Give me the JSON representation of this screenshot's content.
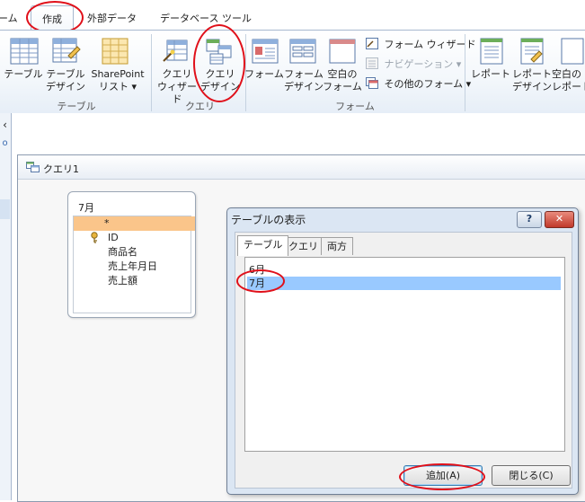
{
  "tabs": [
    "ーム",
    "作成",
    "外部データ",
    "データベース ツール"
  ],
  "ribbon": {
    "table_group": {
      "label": "テーブル",
      "buttons": [
        {
          "line1": "テーブル",
          "line2": ""
        },
        {
          "line1": "テーブル",
          "line2": "デザイン"
        },
        {
          "line1": "SharePoint",
          "line2": "リスト ▾"
        }
      ]
    },
    "query_group": {
      "label": "クエリ",
      "buttons": [
        {
          "line1": "クエリ",
          "line2": "ウィザード"
        },
        {
          "line1": "クエリ",
          "line2": "デザイン"
        }
      ]
    },
    "form_group": {
      "label": "フォーム",
      "buttons": [
        {
          "line1": "フォーム",
          "line2": ""
        },
        {
          "line1": "フォーム",
          "line2": "デザイン"
        },
        {
          "line1": "空白の",
          "line2": "フォーム"
        }
      ],
      "small": [
        "フォーム ウィザード",
        "ナビゲーション ▾",
        "その他のフォーム ▾"
      ]
    },
    "report_group": {
      "buttons": [
        {
          "line1": "レポート",
          "line2": ""
        },
        {
          "line1": "レポート",
          "line2": "デザイン"
        },
        {
          "line1": "空白の",
          "line2": "レポート"
        }
      ]
    }
  },
  "left_strip": {
    "glyph1": "‹",
    "glyph2": "o"
  },
  "query_window": {
    "title": "クエリ1"
  },
  "field_list": {
    "table": "7月",
    "fields": [
      "*",
      "ID",
      "商品名",
      "売上年月日",
      "売上額"
    ]
  },
  "dialog": {
    "title": "テーブルの表示",
    "help": "?",
    "close": "✕",
    "tabs": [
      "テーブル",
      "クエリ",
      "両方"
    ],
    "items": [
      "6月",
      "7月"
    ],
    "selected_index": 1,
    "add_button": "追加(A)",
    "close_button": "閉じる(C)"
  },
  "colors": {
    "highlight": "#e0101a",
    "selection": "#99c9ff"
  }
}
